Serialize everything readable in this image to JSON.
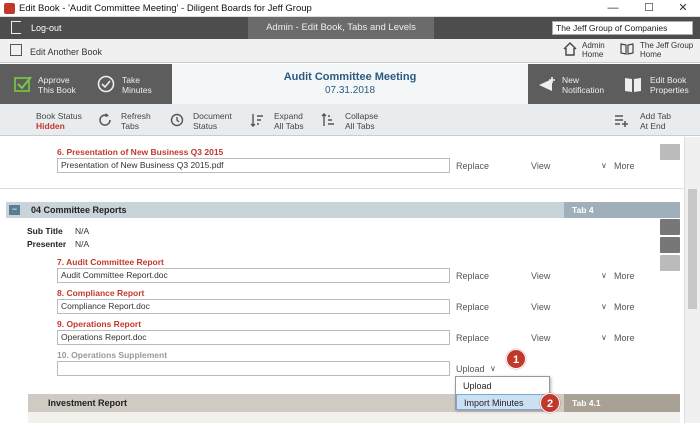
{
  "window": {
    "title": "Edit Book - 'Audit Committee Meeting' - Diligent Boards for Jeff Group",
    "minimize": "—",
    "maximize": "☐",
    "close": "✕"
  },
  "topbar": {
    "logout": "Log-out",
    "center": "Admin - Edit Book, Tabs and Levels",
    "org": "The Jeff Group of Companies"
  },
  "bar2": {
    "edit_another": "Edit Another Book",
    "admin_home_1": "Admin",
    "admin_home_2": "Home",
    "group_home_1": "The Jeff Group",
    "group_home_2": "Home"
  },
  "header": {
    "approve_1": "Approve",
    "approve_2": "This Book",
    "take_1": "Take",
    "take_2": "Minutes",
    "meeting_title": "Audit Committee Meeting",
    "meeting_date": "07.31.2018",
    "new_notif_1": "New",
    "new_notif_2": "Notification",
    "props_1": "Edit Book",
    "props_2": "Properties"
  },
  "toolbar": {
    "book_status": "Book Status",
    "hidden": "Hidden",
    "refresh_1": "Refresh",
    "refresh_2": "Tabs",
    "docstatus_1": "Document",
    "docstatus_2": "Status",
    "expand_1": "Expand",
    "expand_2": "All Tabs",
    "collapse_1": "Collapse",
    "collapse_2": "All Tabs",
    "addtab_1": "Add Tab",
    "addtab_2": "At End"
  },
  "actions": {
    "replace": "Replace",
    "view": "View",
    "more": "More",
    "upload": "Upload",
    "chev": "∨"
  },
  "docs": [
    {
      "label": "6. Presentation of New Business Q3 2015",
      "file": "Presentation of New Business Q3 2015.pdf"
    },
    {
      "label": "7. Audit Committee Report",
      "file": "Audit Committee Report.doc"
    },
    {
      "label": "8. Compliance Report",
      "file": "Compliance Report.doc"
    },
    {
      "label": "9. Operations Report",
      "file": "Operations Report.doc"
    },
    {
      "label": "10. Operations Supplement",
      "file": ""
    }
  ],
  "section": {
    "toggle": "−",
    "title": "04 Committee Reports",
    "tab": "Tab 4",
    "subtitle_label": "Sub Title",
    "subtitle_value": "N/A",
    "presenter_label": "Presenter",
    "presenter_value": "N/A"
  },
  "subsection": {
    "title": "Investment Report",
    "tab": "Tab 4.1"
  },
  "dropdown": {
    "upload": "Upload",
    "import_minutes": "Import Minutes"
  },
  "badges": {
    "one": "1",
    "two": "2"
  }
}
